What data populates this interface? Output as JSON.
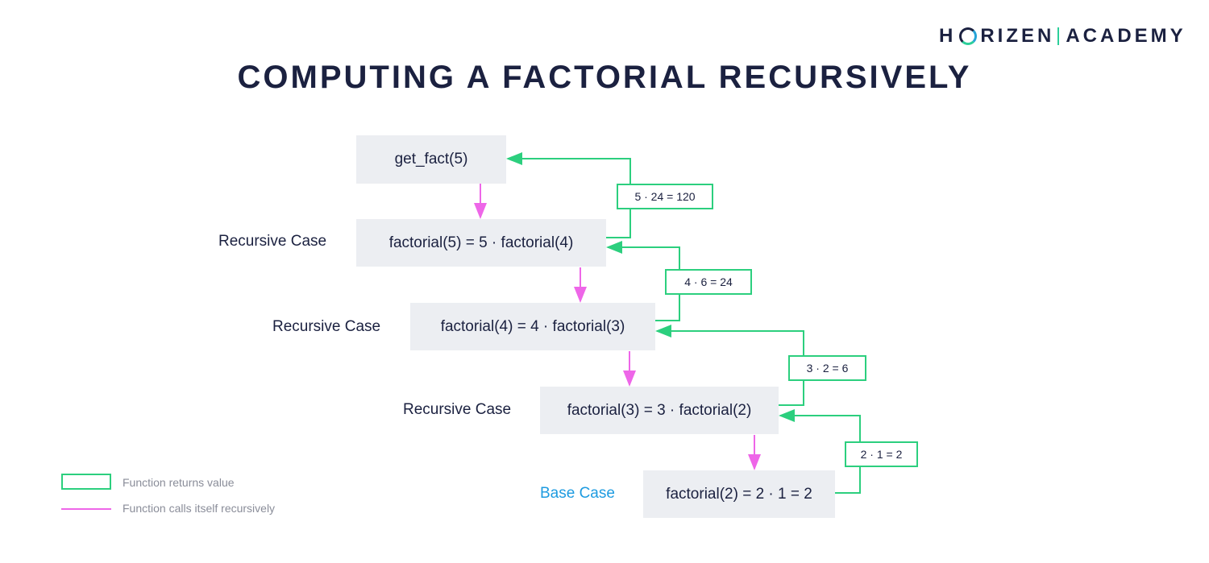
{
  "brand": {
    "left": "H",
    "logo_o": "O",
    "right": "RIZEN",
    "academy": "ACADEMY"
  },
  "title": "COMPUTING A FACTORIAL RECURSIVELY",
  "nodes": [
    {
      "text": "get_fact(5)",
      "case": ""
    },
    {
      "text": "factorial(5) = 5 · factorial(4)",
      "case": "Recursive Case"
    },
    {
      "text": "factorial(4) = 4 · factorial(3)",
      "case": "Recursive Case"
    },
    {
      "text": "factorial(3) = 3 · factorial(2)",
      "case": "Recursive Case"
    },
    {
      "text": "factorial(2) = 2 · 1 = 2",
      "case": "Base Case"
    }
  ],
  "returns": [
    {
      "text": "5 · 24 = 120"
    },
    {
      "text": "4 · 6 = 24"
    },
    {
      "text": "3 · 2 = 6"
    },
    {
      "text": "2 · 1 = 2"
    }
  ],
  "legend": {
    "returns": "Function returns value",
    "calls": "Function calls itself recursively"
  },
  "colors": {
    "return": "#2ccf7e",
    "call": "#ee66e8",
    "base_case": "#1e9be0",
    "box": "#eceef2"
  }
}
